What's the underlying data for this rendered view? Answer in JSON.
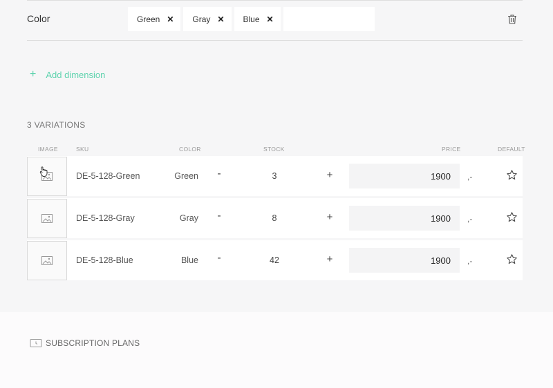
{
  "dimension": {
    "name": "Color",
    "tags": [
      {
        "label": "Green"
      },
      {
        "label": "Gray"
      },
      {
        "label": "Blue"
      }
    ]
  },
  "add_dimension": {
    "label": "Add dimension",
    "icon": "plus-icon"
  },
  "variations": {
    "title": "3 VARIATIONS",
    "columns": {
      "image": "IMAGE",
      "sku": "SKU",
      "color": "COLOR",
      "stock": "STOCK",
      "price": "PRICE",
      "default": "DEFAULT"
    },
    "rows": [
      {
        "sku": "DE-5-128-Green",
        "color": "Green",
        "minus": "-",
        "stock": "3",
        "plus": "+",
        "price": "1900",
        "suffix": ",-"
      },
      {
        "sku": "DE-5-128-Gray",
        "color": "Gray",
        "minus": "-",
        "stock": "8",
        "plus": "+",
        "price": "1900",
        "suffix": ",-"
      },
      {
        "sku": "DE-5-128-Blue",
        "color": "Blue",
        "minus": "-",
        "stock": "42",
        "plus": "+",
        "price": "1900",
        "suffix": ",-"
      }
    ]
  },
  "subscription_plans": {
    "label": "SUBSCRIPTION PLANS",
    "icon": "subscription-icon"
  },
  "colors": {
    "accent": "#5fd3ae"
  }
}
